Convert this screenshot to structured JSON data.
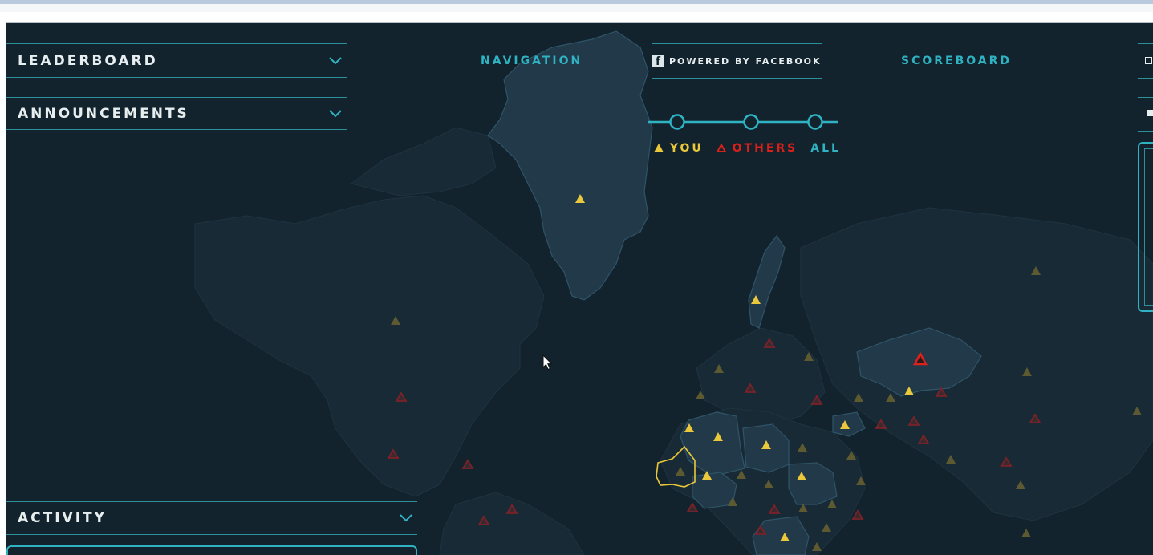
{
  "panels": {
    "leaderboard": "LEADERBOARD",
    "announcements": "ANNOUNCEMENTS",
    "activity": "ACTIVITY"
  },
  "nav": {
    "navigation": "NAVIGATION",
    "powered_by": "POWERED BY FACEBOOK",
    "scoreboard": "SCOREBOARD",
    "facebook_glyph": "f"
  },
  "filters": {
    "you": "YOU",
    "others": "OTHERS",
    "all": "ALL"
  },
  "colors": {
    "background": "#13232d",
    "accent": "#2fb3c2",
    "you": "#e9c93b",
    "others": "#d9201a",
    "land": "#1c303b",
    "land_highlight": "#22394a"
  },
  "icons": [
    "chevron-down-icon",
    "facebook-icon",
    "triangle-you-icon",
    "triangle-others-icon",
    "cursor-icon"
  ]
}
